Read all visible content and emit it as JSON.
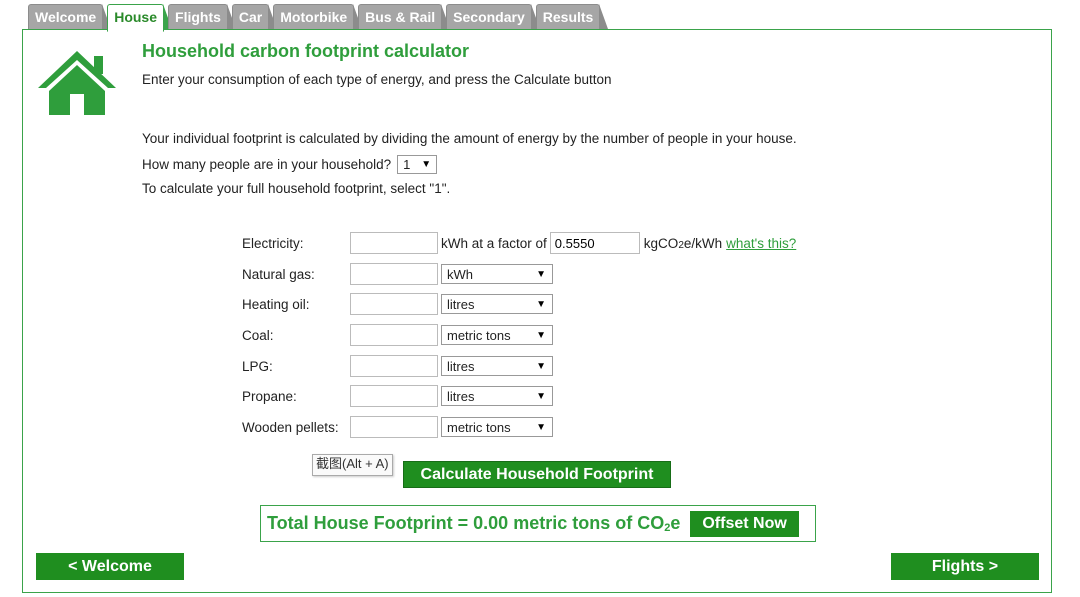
{
  "tabs": [
    {
      "label": "Welcome",
      "active": false
    },
    {
      "label": "House",
      "active": true
    },
    {
      "label": "Flights",
      "active": false
    },
    {
      "label": "Car",
      "active": false
    },
    {
      "label": "Motorbike",
      "active": false
    },
    {
      "label": "Bus & Rail",
      "active": false
    },
    {
      "label": "Secondary",
      "active": false
    },
    {
      "label": "Results",
      "active": false
    }
  ],
  "header": {
    "title": "Household carbon footprint calculator",
    "subtitle": "Enter your consumption of each type of energy, and press the Calculate button",
    "icon": "house-icon"
  },
  "info": {
    "line1": "Your individual footprint is calculated by dividing the amount of energy by the number of people in your house.",
    "people_question": "How many people are in your household?",
    "people_value": "1",
    "line3": "To calculate your full household footprint, select \"1\"."
  },
  "electricity": {
    "label": "Electricity:",
    "value": "",
    "factor_text": "kWh at a factor of",
    "factor_value": "0.5550",
    "factor_unit": "kgCO2e/kWh",
    "help_link": "what's this?"
  },
  "fuels": [
    {
      "label": "Natural gas:",
      "value": "",
      "unit": "kWh"
    },
    {
      "label": "Heating oil:",
      "value": "",
      "unit": "litres"
    },
    {
      "label": "Coal:",
      "value": "",
      "unit": "metric tons"
    },
    {
      "label": "LPG:",
      "value": "",
      "unit": "litres"
    },
    {
      "label": "Propane:",
      "value": "",
      "unit": "litres"
    },
    {
      "label": "Wooden pellets:",
      "value": "",
      "unit": "metric tons"
    }
  ],
  "screenshot_tip": "截图(Alt + A)",
  "calculate_label": "Calculate Household Footprint",
  "total": {
    "text": "Total House Footprint = 0.00 metric tons of CO",
    "sub": "2",
    "suffix": "e",
    "offset_label": "Offset Now"
  },
  "nav": {
    "prev_label": "< Welcome",
    "next_label": "Flights >"
  },
  "colors": {
    "brand_green": "#2f9e3c",
    "button_green": "#1f8e1f",
    "tab_grey": "#a6a6a6"
  }
}
